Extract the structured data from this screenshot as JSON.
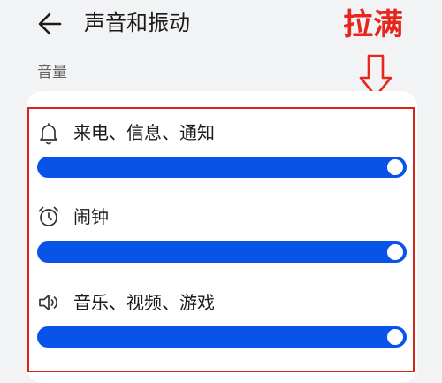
{
  "header": {
    "title": "声音和振动",
    "back_icon": "arrow-left-icon"
  },
  "annotation": {
    "text": "拉满",
    "color": "#e8261e",
    "arrow_icon": "down-arrow-icon"
  },
  "section": {
    "title": "音量"
  },
  "volume_rows": [
    {
      "label": "来电、信息、通知",
      "icon": "bell-icon",
      "level": 1.0
    },
    {
      "label": "闹钟",
      "icon": "alarm-clock-icon",
      "level": 1.0
    },
    {
      "label": "音乐、视频、游戏",
      "icon": "speaker-icon",
      "level": 1.0
    }
  ],
  "colors": {
    "slider": "#0a53e8",
    "highlight_border": "#d9221b"
  }
}
